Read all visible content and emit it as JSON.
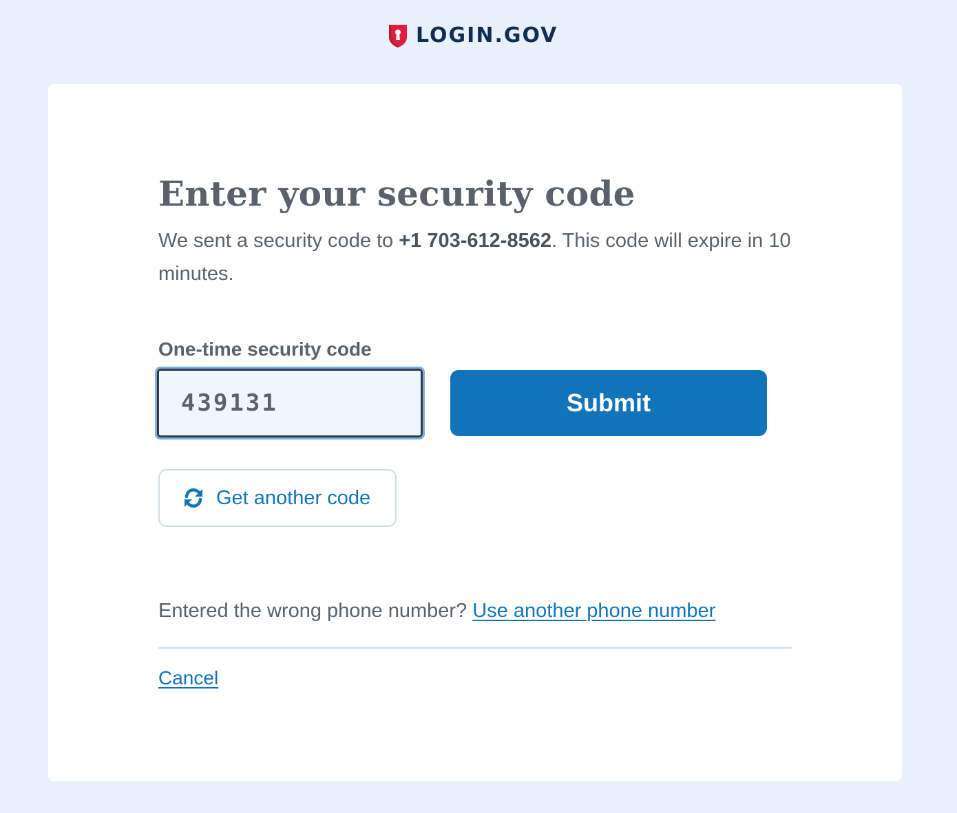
{
  "header": {
    "logo_text": "LOGIN.GOV",
    "logo_icon": "shield-keyhole-icon",
    "brand_colors": {
      "shield": "#e21c3d",
      "text": "#112e51"
    }
  },
  "main": {
    "title": "Enter your security code",
    "intro": {
      "before": "We sent a security code to ",
      "phone": "+1 703-612-8562",
      "after": ". This code will expire in 10 minutes."
    },
    "code_field": {
      "label": "One-time security code",
      "value": "439131"
    },
    "submit_label": "Submit",
    "resend": {
      "label": "Get another code",
      "icon": "refresh-icon"
    },
    "wrong_phone": {
      "prompt": "Entered the wrong phone number? ",
      "link_label": "Use another phone number"
    },
    "cancel_label": "Cancel"
  },
  "colors": {
    "page_background": "#e8f1f9",
    "card_background": "#ffffff",
    "primary": "#1174bb",
    "text": "#5b616b"
  }
}
